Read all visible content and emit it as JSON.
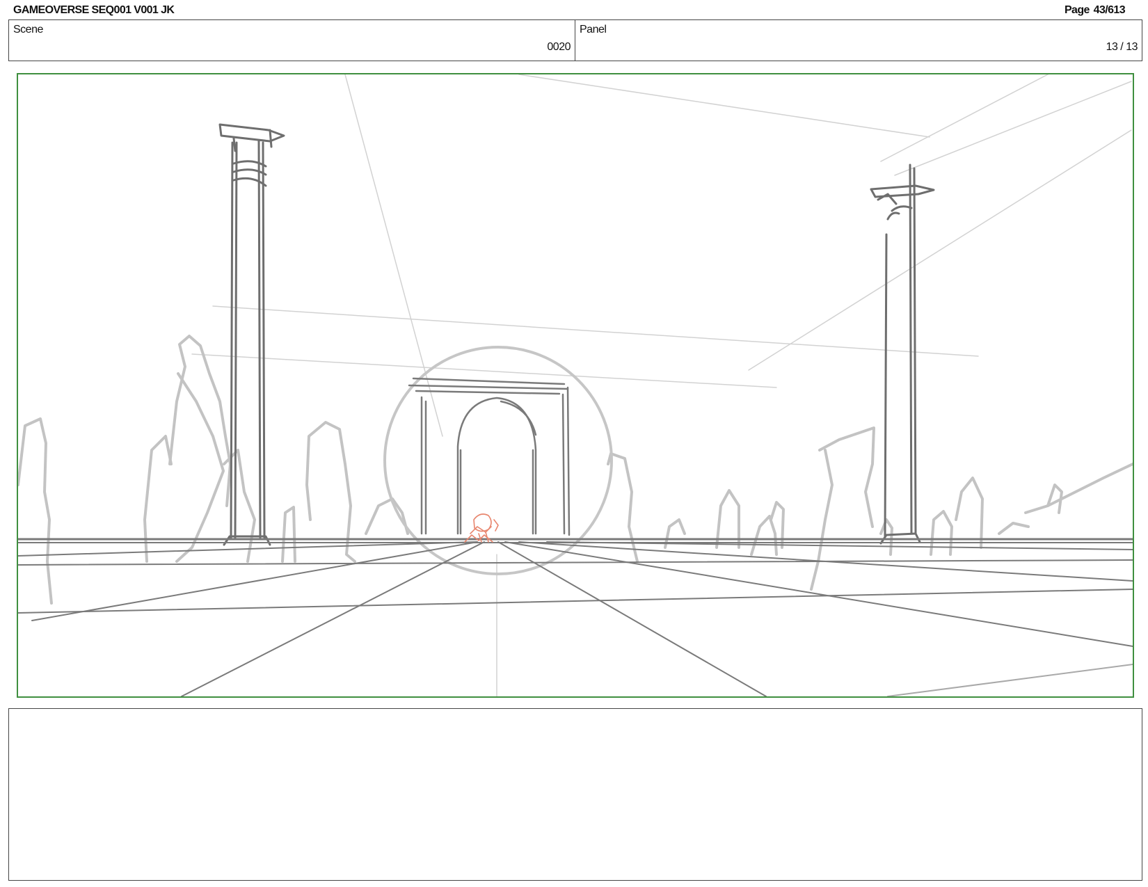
{
  "header": {
    "title": "GAMEOVERSE SEQ001 V001 JK",
    "page": "Page  43/613"
  },
  "info": {
    "scene_label": "Scene",
    "scene_value": "0020",
    "panel_label": "Panel",
    "panel_value": "13 / 13"
  },
  "colors": {
    "frame_border": "#3f8f3f",
    "sketch_dark": "#707070",
    "sketch_light": "#bdbdbd",
    "character": "#e8866e"
  },
  "notes": {
    "text": ""
  }
}
